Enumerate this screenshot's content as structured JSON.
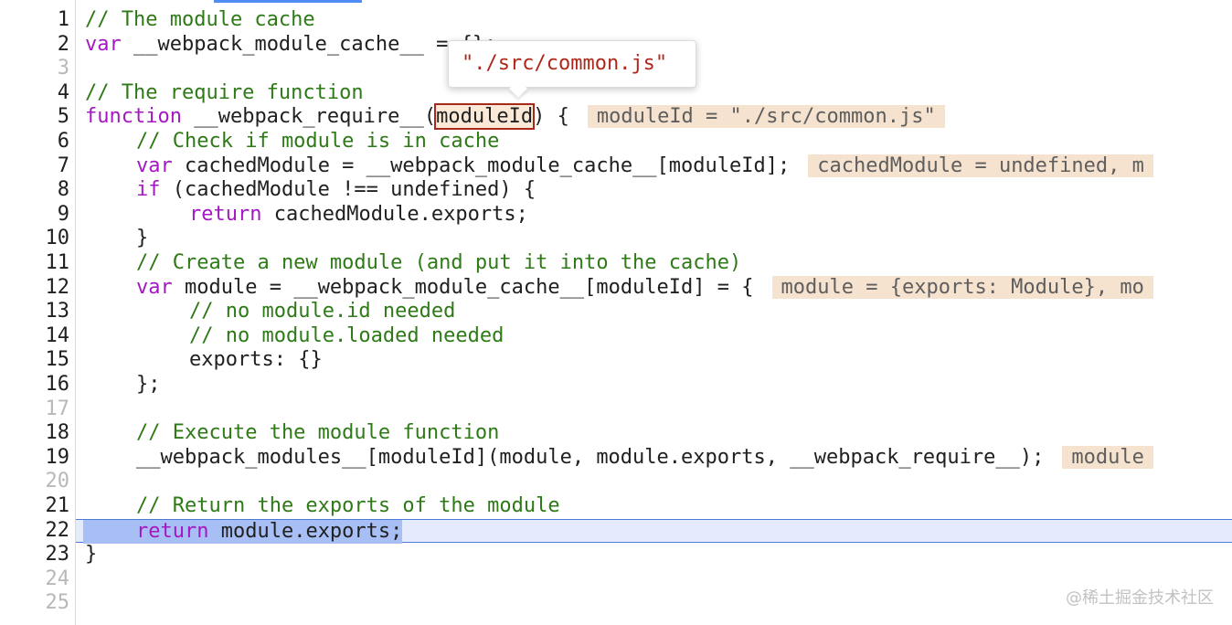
{
  "line_numbers": [
    "1",
    "2",
    "3",
    "4",
    "5",
    "6",
    "7",
    "8",
    "9",
    "10",
    "11",
    "12",
    "13",
    "14",
    "15",
    "16",
    "17",
    "18",
    "19",
    "20",
    "21",
    "22",
    "23",
    "24",
    "25"
  ],
  "code": {
    "l1": "// The module cache",
    "l2_kw": "var",
    "l2_rest": " __webpack_module_cache__ = {};",
    "l4": "// The require function",
    "l5_kw": "function",
    "l5_a": " __webpack_require__(",
    "l5_param": "moduleId",
    "l5_b": ") {",
    "l5_inline": "moduleId = \"./src/common.js\"",
    "l6": "// Check if module is in cache",
    "l7_kw": "var",
    "l7_rest": " cachedModule = __webpack_module_cache__[moduleId];",
    "l7_inline": "cachedModule = undefined, m",
    "l8_kw": "if",
    "l8_rest": " (cachedModule !== undefined) {",
    "l9_kw": "return",
    "l9_rest": " cachedModule.exports;",
    "l10": "}",
    "l11": "// Create a new module (and put it into the cache)",
    "l12_kw": "var",
    "l12_rest": " module = __webpack_module_cache__[moduleId] = {",
    "l12_inline": "module = {exports: Module}, mo",
    "l13": "// no module.id needed",
    "l14": "// no module.loaded needed",
    "l15": "exports: {}",
    "l16": "};",
    "l18": "// Execute the module function",
    "l19": "__webpack_modules__[moduleId](module, module.exports, __webpack_require__);",
    "l19_inline": "module",
    "l21": "// Return the exports of the module",
    "l22_kw": "return",
    "l22_rest": " module.exports;",
    "l23": "}"
  },
  "tooltip": {
    "value": "\"./src/common.js\""
  },
  "watermark": "@稀土掘金技术社区",
  "colors": {
    "keyword": "#a418c2",
    "comment": "#2d7a16",
    "string": "#b0271a",
    "current_line": "#e3ebfc",
    "inline_value_bg": "#f6e3cf"
  }
}
